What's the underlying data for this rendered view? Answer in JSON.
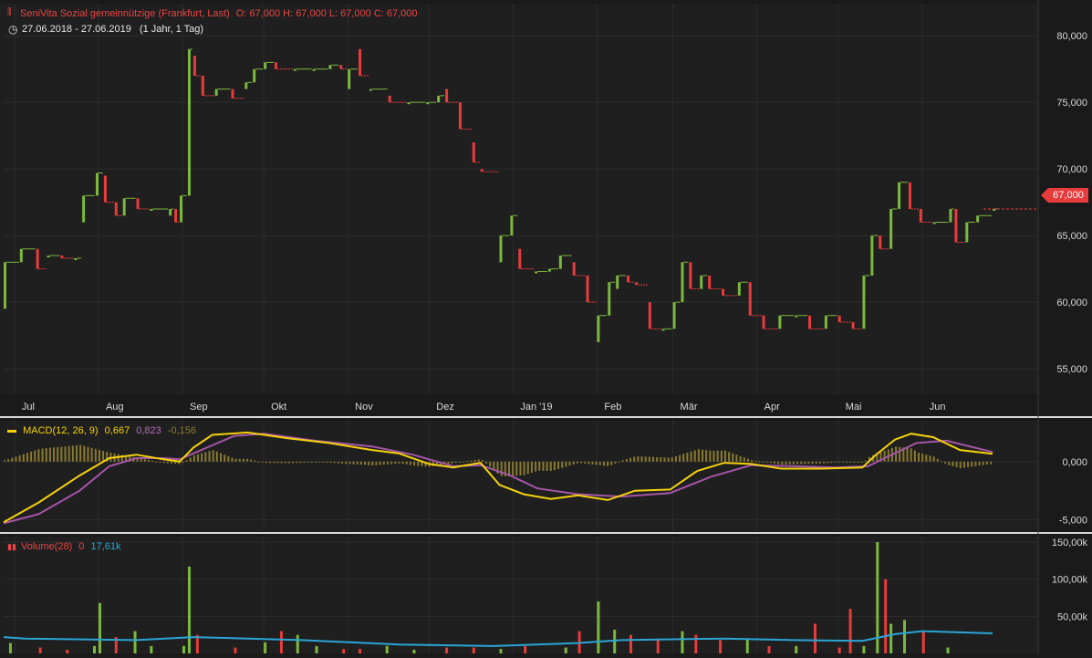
{
  "header": {
    "instrument": "SeniVita Sozial gemeinnützige (Frankfurt, Last)",
    "ohlc": "O: 67,000  H: 67,000  L: 67,000  C: 67,000",
    "range": "27.06.2018 - 27.06.2019",
    "interval": "(1 Jahr, 1 Tag)"
  },
  "last_price_badge": "67,000",
  "colors": {
    "background": "#1a1a1a",
    "up": "#7cb83e",
    "down": "#e83b3b",
    "macd": "#f5d20a",
    "signal": "#a656a8",
    "histogram": "#8a7a30",
    "volume_avg": "#2aa5d6",
    "badge": "#e83b3b"
  },
  "macd_legend": {
    "name": "MACD(12, 26, 9)",
    "macd": "0,667",
    "signal": "0,823",
    "hist": "-0,156"
  },
  "volume_legend": {
    "name": "Volume(28)",
    "last": "0",
    "avg": "17,61k"
  },
  "chart_data": [
    {
      "type": "candlestick",
      "title": "SeniVita Sozial gemeinnützige (Frankfurt, Last)",
      "x_ticks": [
        "Jul",
        "Aug",
        "Sep",
        "Okt",
        "Nov",
        "Dez",
        "Jan '19",
        "Feb",
        "Mär",
        "Apr",
        "Mai",
        "Jun"
      ],
      "y_ticks": [
        "55,000",
        "60,000",
        "65,000",
        "70,000",
        "75,000",
        "80,000"
      ],
      "ylim": [
        53.5,
        82
      ],
      "segments": [
        [
          "2018-06-27",
          59.5,
          63
        ],
        [
          "2018-07-03",
          63,
          64
        ],
        [
          "2018-07-09",
          64,
          62.5
        ],
        [
          "2018-07-13",
          63.5,
          63.5
        ],
        [
          "2018-07-18",
          63.5,
          63.3
        ],
        [
          "2018-07-23",
          63.3,
          63.3
        ],
        [
          "2018-07-26",
          66,
          68
        ],
        [
          "2018-07-31",
          68,
          69.7
        ],
        [
          "2018-08-03",
          69.5,
          67.5
        ],
        [
          "2018-08-07",
          67.5,
          66.5
        ],
        [
          "2018-08-10",
          66.5,
          67.8
        ],
        [
          "2018-08-15",
          67.8,
          67
        ],
        [
          "2018-08-20",
          67,
          67
        ],
        [
          "2018-08-27",
          66.5,
          67
        ],
        [
          "2018-08-29",
          67,
          66
        ],
        [
          "2018-08-31",
          66,
          68
        ],
        [
          "2018-09-03",
          68,
          79
        ],
        [
          "2018-09-05",
          78.5,
          77
        ],
        [
          "2018-09-08",
          77,
          75.5
        ],
        [
          "2018-09-13",
          75.5,
          76
        ],
        [
          "2018-09-19",
          76,
          75.3
        ],
        [
          "2018-09-24",
          76,
          76.5
        ],
        [
          "2018-09-27",
          76.5,
          77.5
        ],
        [
          "2018-10-01",
          77.5,
          78
        ],
        [
          "2018-10-05",
          78,
          77.5
        ],
        [
          "2018-10-12",
          77.5,
          77.5
        ],
        [
          "2018-10-19",
          77.5,
          77.5
        ],
        [
          "2018-10-25",
          77.5,
          77.8
        ],
        [
          "2018-10-29",
          77.8,
          77.5
        ],
        [
          "2018-11-01",
          76,
          77.5
        ],
        [
          "2018-11-05",
          79,
          77
        ],
        [
          "2018-11-09",
          76,
          76
        ],
        [
          "2018-11-16",
          75.5,
          75
        ],
        [
          "2018-11-23",
          75,
          75
        ],
        [
          "2018-11-30",
          75,
          75
        ],
        [
          "2018-12-04",
          75,
          75.5
        ],
        [
          "2018-12-07",
          76,
          75
        ],
        [
          "2018-12-12",
          75,
          73
        ],
        [
          "2018-12-17",
          72,
          70.5
        ],
        [
          "2018-12-20",
          70,
          69.8
        ],
        [
          "2018-12-27",
          63,
          65
        ],
        [
          "2018-12-31",
          65,
          66.5
        ],
        [
          "2019-01-03",
          64,
          62.5
        ],
        [
          "2019-01-09",
          62.3,
          62.3
        ],
        [
          "2019-01-14",
          62.3,
          62.5
        ],
        [
          "2019-01-18",
          62.5,
          63.5
        ],
        [
          "2019-01-23",
          63,
          62
        ],
        [
          "2019-01-28",
          62,
          60
        ],
        [
          "2019-02-01",
          57,
          59
        ],
        [
          "2019-02-05",
          59,
          61.5
        ],
        [
          "2019-02-08",
          61,
          62
        ],
        [
          "2019-02-12",
          62,
          61.5
        ],
        [
          "2019-02-15",
          61.5,
          61.3
        ],
        [
          "2019-02-20",
          60,
          58
        ],
        [
          "2019-02-25",
          58,
          58
        ],
        [
          "2019-03-01",
          58,
          60
        ],
        [
          "2019-03-04",
          60,
          63
        ],
        [
          "2019-03-07",
          63,
          61
        ],
        [
          "2019-03-11",
          61,
          62
        ],
        [
          "2019-03-14",
          62,
          61
        ],
        [
          "2019-03-19",
          61,
          60.5
        ],
        [
          "2019-03-25",
          60.5,
          61.5
        ],
        [
          "2019-03-29",
          61.5,
          59
        ],
        [
          "2019-04-03",
          59,
          58
        ],
        [
          "2019-04-09",
          58,
          59
        ],
        [
          "2019-04-15",
          59,
          59
        ],
        [
          "2019-04-20",
          59,
          58
        ],
        [
          "2019-04-26",
          58,
          59
        ],
        [
          "2019-05-01",
          59,
          58.5
        ],
        [
          "2019-05-06",
          58.5,
          58
        ],
        [
          "2019-05-10",
          58,
          62
        ],
        [
          "2019-05-13",
          62,
          65
        ],
        [
          "2019-05-16",
          65,
          64
        ],
        [
          "2019-05-20",
          64,
          67
        ],
        [
          "2019-05-23",
          67,
          69
        ],
        [
          "2019-05-27",
          69,
          67
        ],
        [
          "2019-05-31",
          67,
          66
        ],
        [
          "2019-06-05",
          66,
          66
        ],
        [
          "2019-06-11",
          66,
          67
        ],
        [
          "2019-06-13",
          67,
          64.5
        ],
        [
          "2019-06-17",
          64.5,
          66
        ],
        [
          "2019-06-21",
          66,
          66.5
        ],
        [
          "2019-06-27",
          67,
          67
        ]
      ],
      "last": 67.0
    },
    {
      "type": "line",
      "title": "MACD(12, 26, 9)",
      "y_ticks": [
        "-5,000",
        "0,000"
      ],
      "ylim": [
        -5.5,
        3.2
      ],
      "series": [
        {
          "name": "MACD",
          "values": [
            [
              "2018-06-27",
              -5.2
            ],
            [
              "2018-07-10",
              -3.5
            ],
            [
              "2018-07-25",
              -1.2
            ],
            [
              "2018-08-05",
              0.3
            ],
            [
              "2018-08-15",
              0.6
            ],
            [
              "2018-08-25",
              0.2
            ],
            [
              "2018-08-31",
              0.0
            ],
            [
              "2018-09-05",
              1.2
            ],
            [
              "2018-09-12",
              2.3
            ],
            [
              "2018-09-25",
              2.5
            ],
            [
              "2018-10-10",
              2.0
            ],
            [
              "2018-10-25",
              1.6
            ],
            [
              "2018-11-10",
              1.0
            ],
            [
              "2018-11-20",
              0.7
            ],
            [
              "2018-12-01",
              -0.2
            ],
            [
              "2018-12-10",
              -0.5
            ],
            [
              "2018-12-20",
              -0.1
            ],
            [
              "2018-12-27",
              -2.0
            ],
            [
              "2019-01-05",
              -2.8
            ],
            [
              "2019-01-15",
              -3.2
            ],
            [
              "2019-01-25",
              -2.9
            ],
            [
              "2019-02-05",
              -3.3
            ],
            [
              "2019-02-15",
              -2.5
            ],
            [
              "2019-02-28",
              -2.4
            ],
            [
              "2019-03-10",
              -0.8
            ],
            [
              "2019-03-20",
              -0.1
            ],
            [
              "2019-03-30",
              -0.2
            ],
            [
              "2019-04-10",
              -0.6
            ],
            [
              "2019-04-25",
              -0.6
            ],
            [
              "2019-05-10",
              -0.5
            ],
            [
              "2019-05-15",
              0.6
            ],
            [
              "2019-05-22",
              1.9
            ],
            [
              "2019-05-28",
              2.4
            ],
            [
              "2019-06-05",
              2.1
            ],
            [
              "2019-06-15",
              1.0
            ],
            [
              "2019-06-27",
              0.667
            ]
          ]
        },
        {
          "name": "Signal",
          "values": [
            [
              "2018-06-27",
              -5.3
            ],
            [
              "2018-07-10",
              -4.5
            ],
            [
              "2018-07-25",
              -2.5
            ],
            [
              "2018-08-05",
              -0.4
            ],
            [
              "2018-08-15",
              0.3
            ],
            [
              "2018-08-25",
              0.3
            ],
            [
              "2018-08-31",
              0.2
            ],
            [
              "2018-09-10",
              1.2
            ],
            [
              "2018-09-20",
              2.2
            ],
            [
              "2018-10-01",
              2.4
            ],
            [
              "2018-10-20",
              1.8
            ],
            [
              "2018-11-10",
              1.3
            ],
            [
              "2018-11-25",
              0.6
            ],
            [
              "2018-12-10",
              -0.4
            ],
            [
              "2018-12-20",
              -0.3
            ],
            [
              "2018-12-31",
              -1.2
            ],
            [
              "2019-01-10",
              -2.3
            ],
            [
              "2019-01-25",
              -2.8
            ],
            [
              "2019-02-10",
              -3.0
            ],
            [
              "2019-02-28",
              -2.7
            ],
            [
              "2019-03-15",
              -1.3
            ],
            [
              "2019-03-30",
              -0.3
            ],
            [
              "2019-04-15",
              -0.4
            ],
            [
              "2019-04-30",
              -0.5
            ],
            [
              "2019-05-12",
              -0.4
            ],
            [
              "2019-05-20",
              0.5
            ],
            [
              "2019-05-30",
              1.6
            ],
            [
              "2019-06-10",
              1.8
            ],
            [
              "2019-06-27",
              0.823
            ]
          ]
        }
      ]
    },
    {
      "type": "bar",
      "title": "Volume(28)",
      "y_ticks": [
        "50,00k",
        "100,00k",
        "150,00k"
      ],
      "ylim": [
        0,
        150
      ],
      "unit": "k",
      "volumes": [
        [
          "2018-06-29",
          14
        ],
        [
          "2018-07-10",
          8
        ],
        [
          "2018-07-20",
          5
        ],
        [
          "2018-07-30",
          10
        ],
        [
          "2018-08-01",
          68
        ],
        [
          "2018-08-07",
          22
        ],
        [
          "2018-08-14",
          30
        ],
        [
          "2018-08-20",
          10
        ],
        [
          "2018-09-01",
          10
        ],
        [
          "2018-09-03",
          117
        ],
        [
          "2018-09-06",
          25
        ],
        [
          "2018-09-20",
          8
        ],
        [
          "2018-10-01",
          15
        ],
        [
          "2018-10-07",
          30
        ],
        [
          "2018-10-13",
          25
        ],
        [
          "2018-10-20",
          10
        ],
        [
          "2018-10-30",
          6
        ],
        [
          "2018-11-05",
          6
        ],
        [
          "2018-11-15",
          10
        ],
        [
          "2018-11-25",
          5
        ],
        [
          "2018-12-07",
          8
        ],
        [
          "2018-12-17",
          8
        ],
        [
          "2018-12-27",
          6
        ],
        [
          "2019-01-05",
          10
        ],
        [
          "2019-01-20",
          8
        ],
        [
          "2019-01-25",
          30
        ],
        [
          "2019-02-01",
          70
        ],
        [
          "2019-02-07",
          32
        ],
        [
          "2019-02-13",
          25
        ],
        [
          "2019-02-23",
          20
        ],
        [
          "2019-03-04",
          30
        ],
        [
          "2019-03-09",
          25
        ],
        [
          "2019-03-18",
          18
        ],
        [
          "2019-03-28",
          20
        ],
        [
          "2019-04-05",
          10
        ],
        [
          "2019-04-15",
          10
        ],
        [
          "2019-04-22",
          40
        ],
        [
          "2019-05-01",
          8
        ],
        [
          "2019-05-05",
          60
        ],
        [
          "2019-05-10",
          10
        ],
        [
          "2019-05-15",
          150
        ],
        [
          "2019-05-18",
          100
        ],
        [
          "2019-05-20",
          40
        ],
        [
          "2019-05-25",
          45
        ],
        [
          "2019-06-01",
          30
        ],
        [
          "2019-06-10",
          8
        ]
      ],
      "average": [
        [
          "2018-06-27",
          22
        ],
        [
          "2018-07-05",
          20
        ],
        [
          "2018-08-15",
          18
        ],
        [
          "2018-09-05",
          22
        ],
        [
          "2018-10-15",
          18
        ],
        [
          "2018-11-20",
          12
        ],
        [
          "2018-12-25",
          10
        ],
        [
          "2019-01-25",
          14
        ],
        [
          "2019-02-10",
          18
        ],
        [
          "2019-03-20",
          20
        ],
        [
          "2019-04-15",
          18
        ],
        [
          "2019-05-10",
          17
        ],
        [
          "2019-05-22",
          26
        ],
        [
          "2019-06-01",
          30
        ],
        [
          "2019-06-27",
          27
        ]
      ]
    }
  ]
}
